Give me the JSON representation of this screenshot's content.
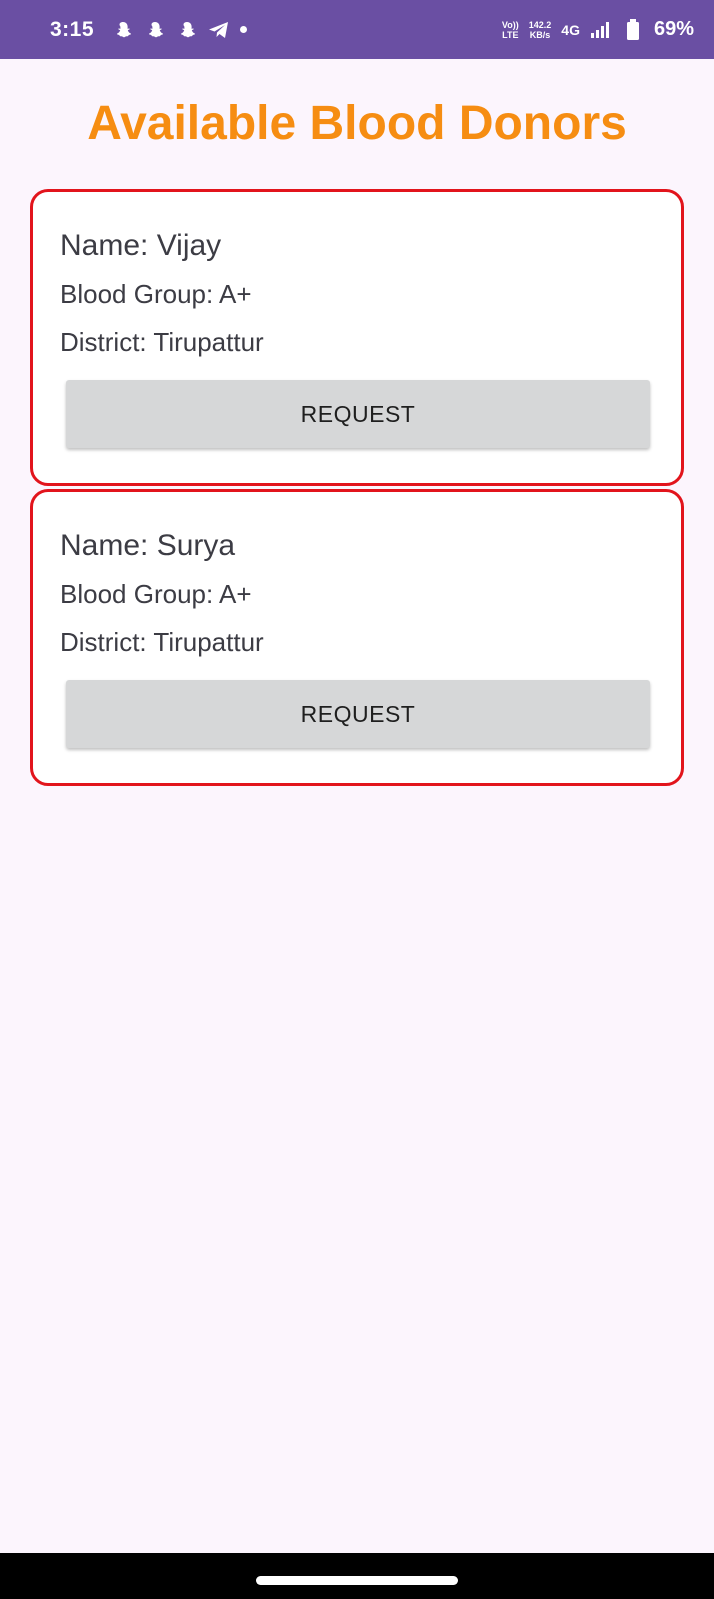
{
  "status_bar": {
    "time": "3:15",
    "notification_icons": [
      "snapchat-icon",
      "snapchat-icon",
      "snapchat-icon",
      "telegram-icon"
    ],
    "volte_top": "Vo))",
    "volte_bottom": "LTE",
    "speed_value": "142.2",
    "speed_unit": "KB/s",
    "network": "4G",
    "battery": "69%"
  },
  "page": {
    "title": "Available Blood Donors",
    "title_color": "#f68d12",
    "card_border_color": "#e2141c"
  },
  "donors": [
    {
      "name": "Name: Vijay",
      "blood_group": "Blood Group: A+",
      "district": "District: Tirupattur",
      "button_label": "REQUEST"
    },
    {
      "name": "Name: Surya",
      "blood_group": "Blood Group: A+",
      "district": "District: Tirupattur",
      "button_label": "REQUEST"
    }
  ]
}
